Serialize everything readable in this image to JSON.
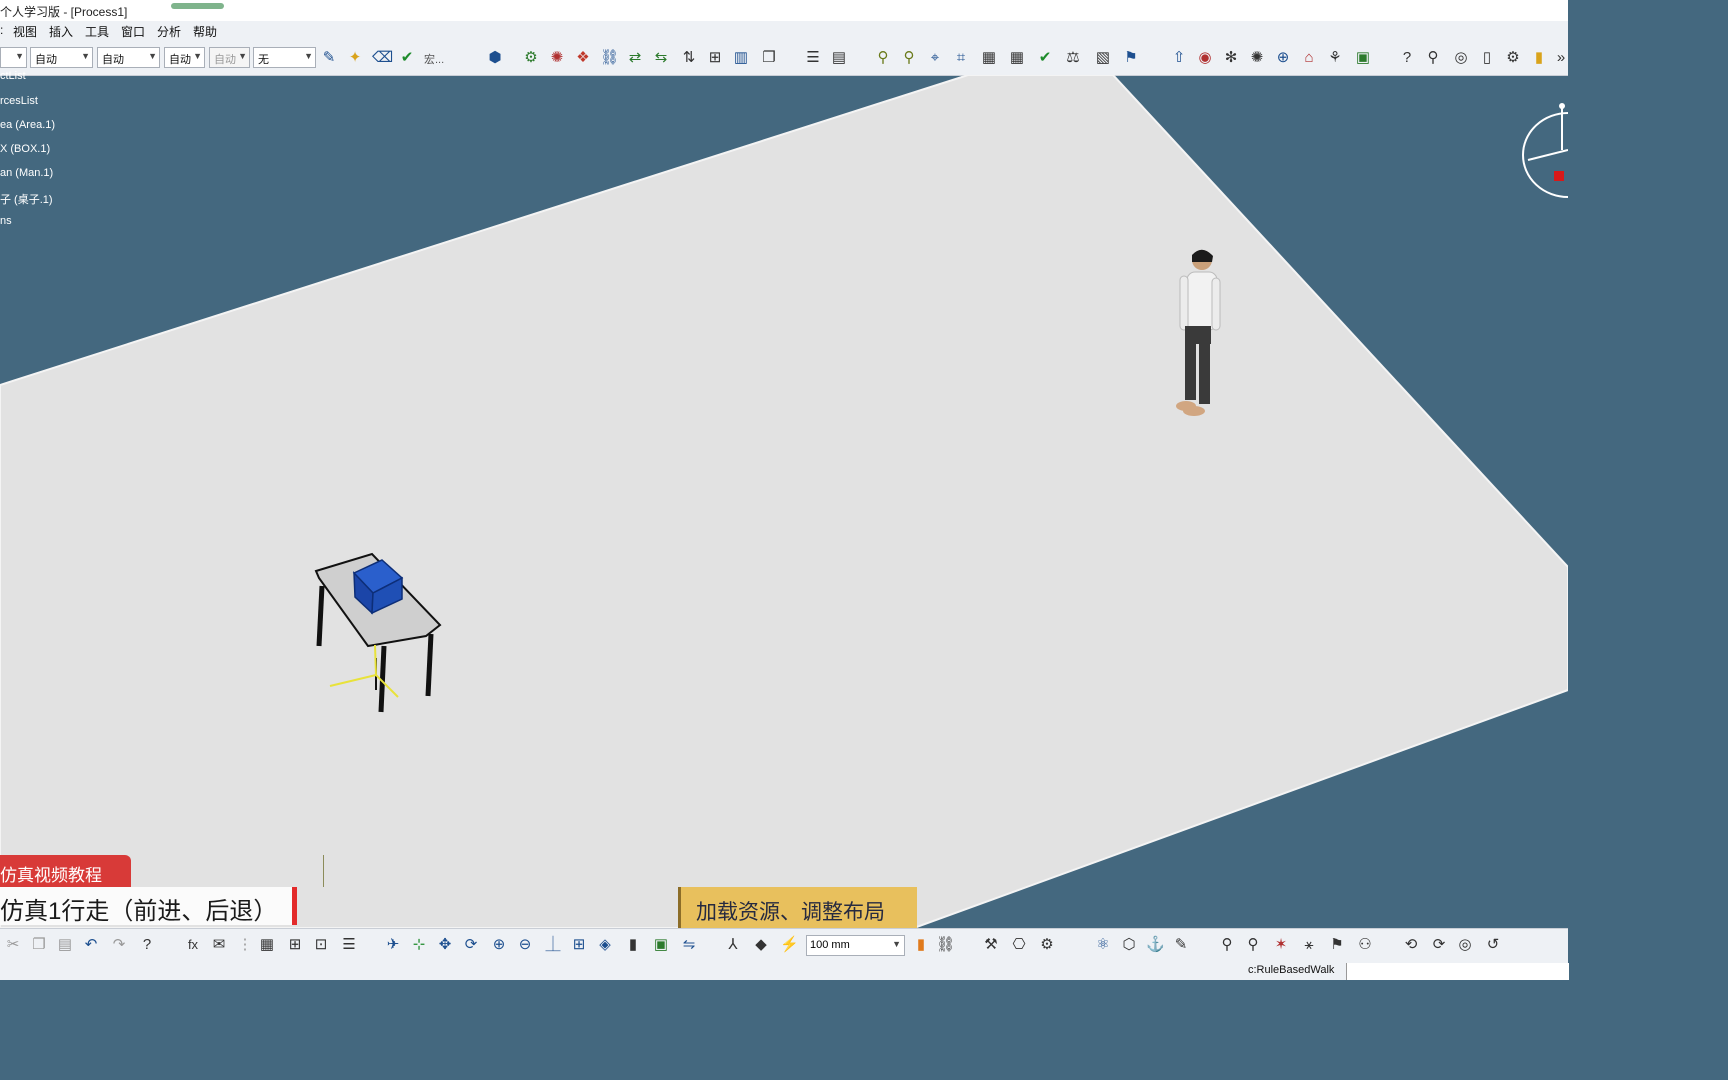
{
  "window": {
    "title": "个人学习版  - [Process1]"
  },
  "menu": [
    "视图",
    "插入",
    "工具",
    "窗口",
    "分析",
    "帮助"
  ],
  "toolbar": {
    "combos": [
      "",
      "自动",
      "自动",
      "自动",
      "自动",
      "无"
    ],
    "label_macro": "宏..."
  },
  "tree": [
    "ctList",
    "rcesList",
    "ea (Area.1)",
    "X (BOX.1)",
    "an (Man.1)",
    "子 (桌子.1)",
    "ns"
  ],
  "overlays": {
    "red_badge": "仿真视频教程",
    "white_banner": "仿真1行走（前进、后退）",
    "yellow_box": "加载资源、调整布局"
  },
  "bottom_toolbar": {
    "unit_value": "100 mm"
  },
  "status": {
    "text": "c:RuleBasedWalk"
  },
  "colors": {
    "background": "#44687f",
    "floor": "#e2e2e2",
    "box": "#1f4fb5",
    "accent_red": "#d83a38",
    "accent_yellow": "#e8c05d"
  }
}
